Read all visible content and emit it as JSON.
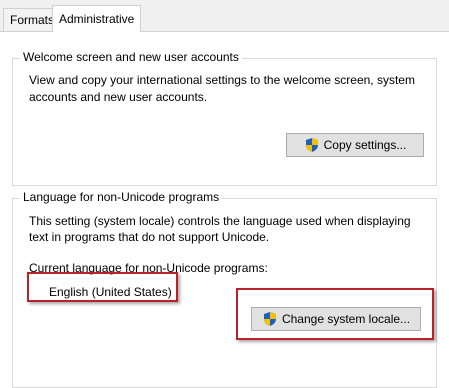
{
  "tabs": [
    {
      "label": "Formats"
    },
    {
      "label": "Administrative"
    }
  ],
  "welcome": {
    "legend": "Welcome screen and new user accounts",
    "description_line1": "View and copy your international settings to the welcome screen, system",
    "description_line2": "accounts and new user accounts.",
    "button_label": "Copy settings..."
  },
  "unicode": {
    "legend": "Language for non-Unicode programs",
    "description_line1": "This setting (system locale) controls the language used when displaying",
    "description_line2": "text in programs that do not support Unicode.",
    "current_label": "Current language for non-Unicode programs:",
    "current_value": "English (United States)",
    "button_label": "Change system locale..."
  },
  "colors": {
    "highlight": "#b8222a",
    "shield_blue": "#1f5fb8",
    "shield_yellow": "#f2c200"
  }
}
